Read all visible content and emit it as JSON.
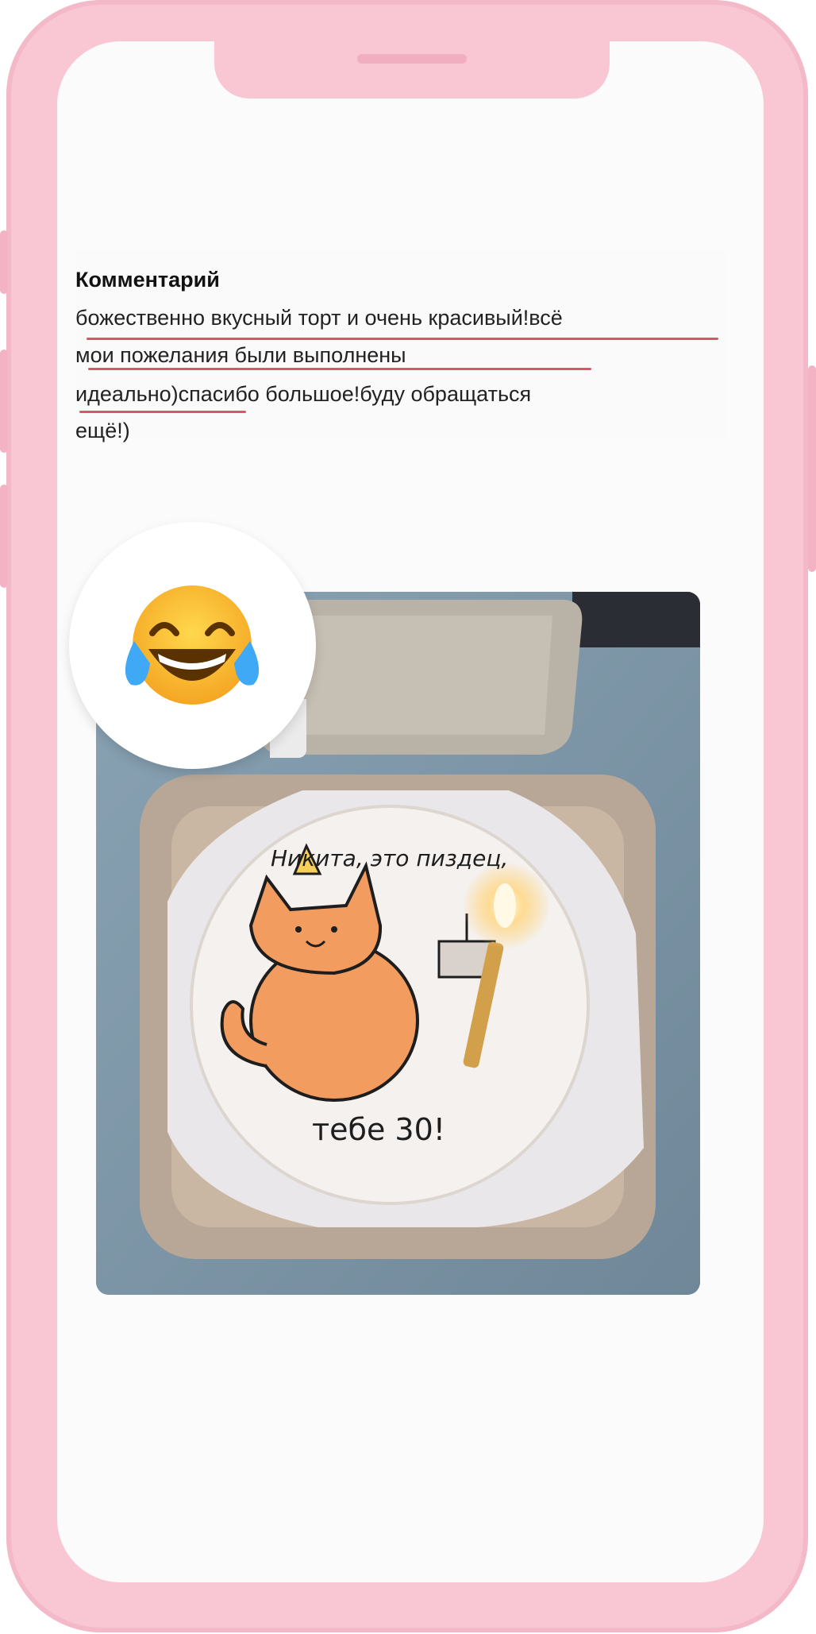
{
  "comment": {
    "title": "Комментарий",
    "lines": [
      "божественно вкусный торт и очень красивый!всё",
      "мои пожелания были выполнены",
      "идеально)спасибо большое!буду обращаться",
      "ещё!)"
    ]
  },
  "reaction": {
    "icon": "face-with-tears-of-joy-icon"
  },
  "photo": {
    "cake_text_top": "Никита, это пиздец,",
    "cake_text_bottom": "тебе 30!"
  },
  "colors": {
    "frame": "#f9c6d4",
    "screen": "#fcfbfc",
    "underline": "#d9566a"
  }
}
